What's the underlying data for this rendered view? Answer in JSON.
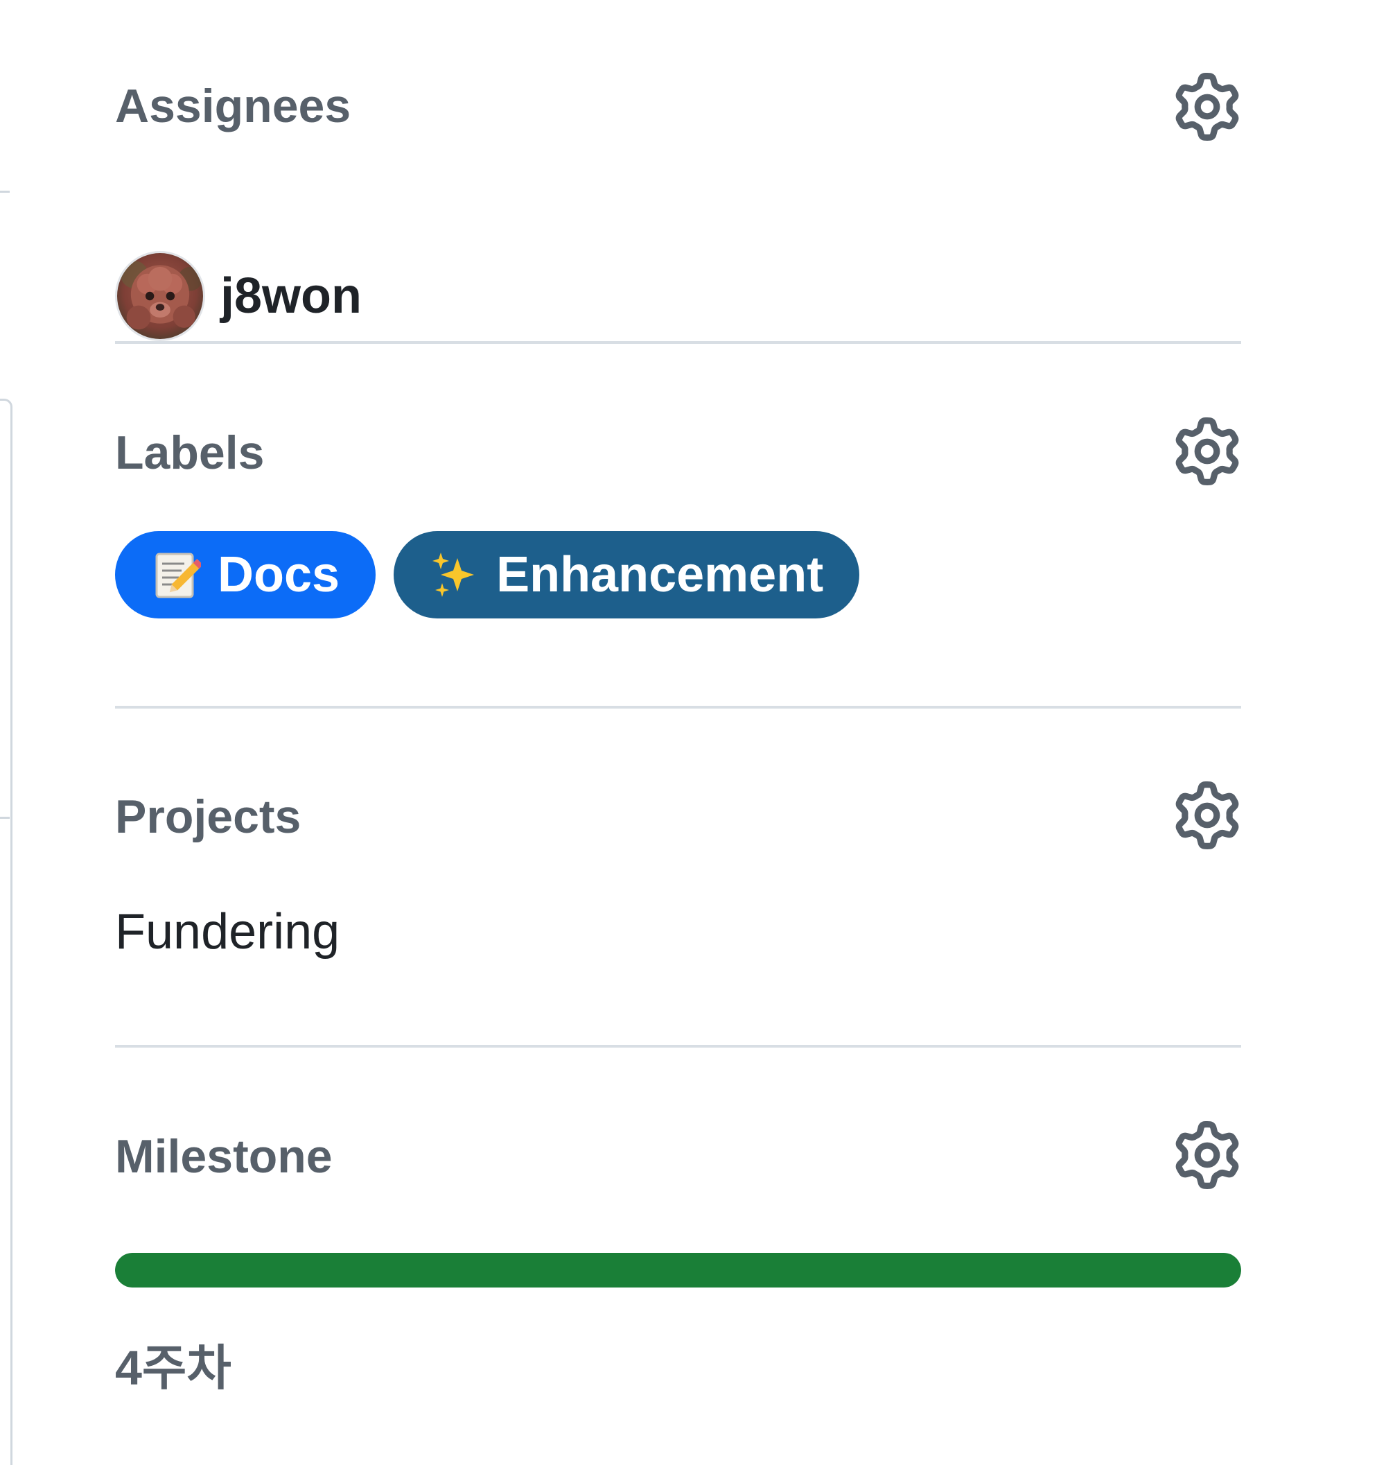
{
  "colors": {
    "heading": "#57606a",
    "text": "#1f2328",
    "gear": "#57606a",
    "divider": "#d8dee4",
    "progress_fill": "#1a7f37"
  },
  "assignees": {
    "title": "Assignees",
    "settings_icon": "gear-icon",
    "users": [
      {
        "login": "j8won",
        "avatar": "avatar-image"
      }
    ]
  },
  "labels": {
    "title": "Labels",
    "settings_icon": "gear-icon",
    "items": [
      {
        "emoji": "memo-icon",
        "name": "Docs",
        "color": "#0c6cf7"
      },
      {
        "emoji": "sparkles-icon",
        "name": "Enhancement",
        "color": "#1d5f8c"
      }
    ]
  },
  "projects": {
    "title": "Projects",
    "settings_icon": "gear-icon",
    "items": [
      {
        "name": "Fundering"
      }
    ]
  },
  "milestone": {
    "title": "Milestone",
    "settings_icon": "gear-icon",
    "progress_percent": 100,
    "name": "4주차"
  }
}
